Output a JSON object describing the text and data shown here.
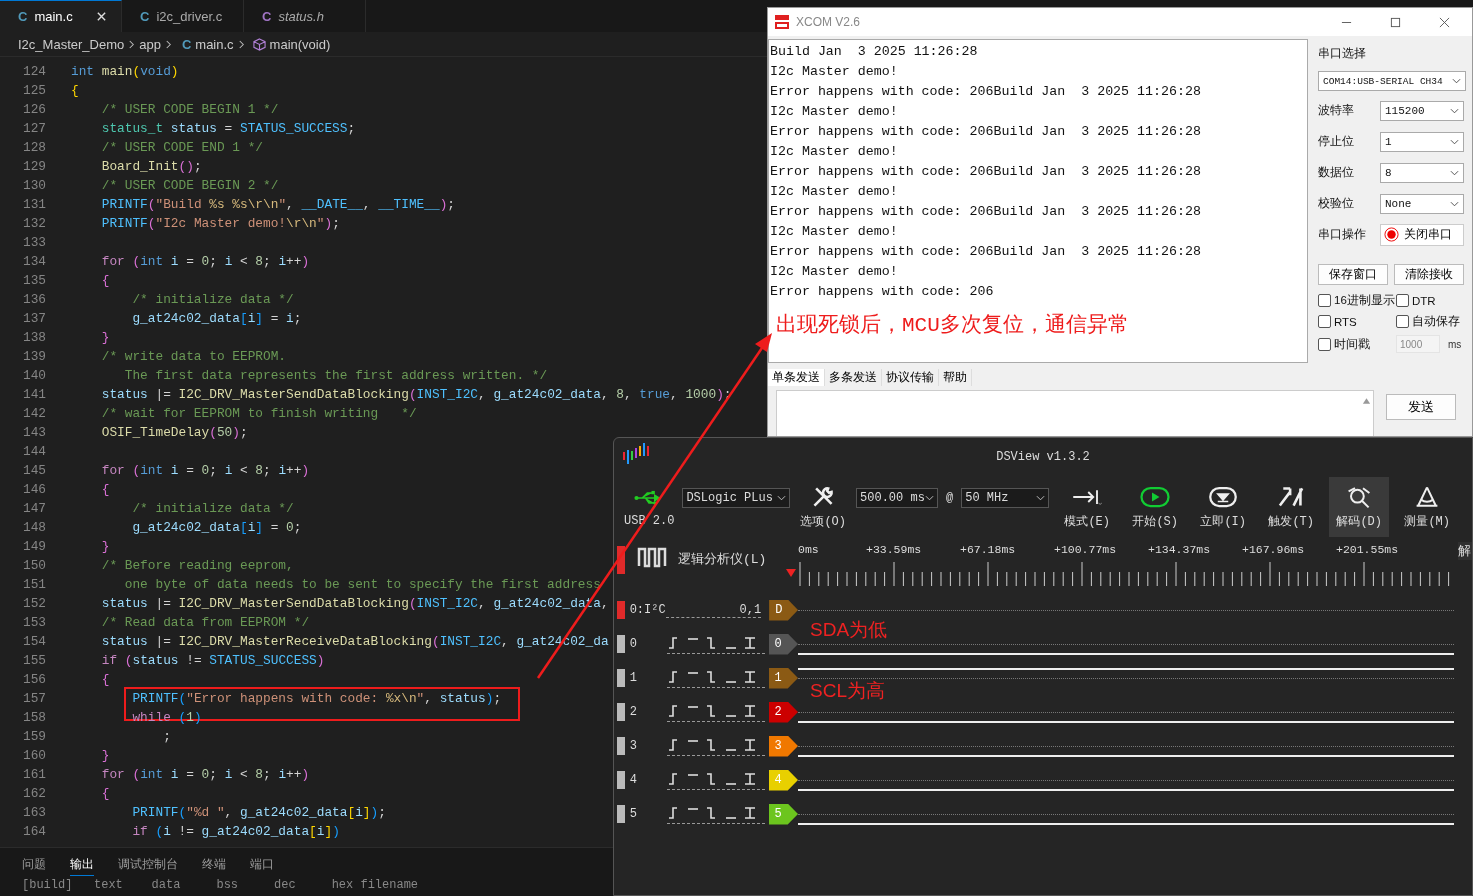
{
  "editor": {
    "tabs": [
      {
        "icon_letter": "C",
        "label": "main.c",
        "selected": true,
        "preview": false
      },
      {
        "icon_letter": "C",
        "label": "i2c_driver.c",
        "selected": false,
        "preview": false
      },
      {
        "icon_letter": "C",
        "label": "status.h",
        "selected": false,
        "preview": true
      }
    ],
    "breadcrumb": [
      {
        "kind": "folder",
        "label": "I2c_Master_Demo"
      },
      {
        "kind": "folder",
        "label": "app"
      },
      {
        "kind": "file",
        "icon_letter": "C",
        "label": "main.c"
      },
      {
        "kind": "function",
        "label": "main(void)"
      }
    ],
    "lines": [
      {
        "number": "124",
        "tokens": [
          {
            "text": "int ",
            "kind": "kw"
          },
          {
            "text": "main",
            "kind": "fn"
          },
          {
            "text": "(",
            "kind": "b1"
          },
          {
            "text": "void",
            "kind": "kw"
          },
          {
            "text": ")",
            "kind": "b1"
          }
        ]
      },
      {
        "number": "125",
        "tokens": [
          {
            "text": "{",
            "kind": "b1"
          }
        ]
      },
      {
        "number": "126",
        "tokens": [
          {
            "text": "    /* USER CODE BEGIN 1 */",
            "kind": "cm"
          }
        ]
      },
      {
        "number": "127",
        "tokens": [
          {
            "text": "    status_t ",
            "kind": "ty"
          },
          {
            "text": "status",
            "kind": "v"
          },
          {
            "text": " = ",
            "kind": "p"
          },
          {
            "text": "STATUS_SUCCESS",
            "kind": "c"
          },
          {
            "text": ";",
            "kind": "p"
          }
        ]
      },
      {
        "number": "128",
        "tokens": [
          {
            "text": "    /* USER CODE END 1 */",
            "kind": "cm"
          }
        ]
      },
      {
        "number": "129",
        "tokens": [
          {
            "text": "    Board_Init",
            "kind": "fn"
          },
          {
            "text": "()",
            "kind": "b2"
          },
          {
            "text": ";",
            "kind": "p"
          }
        ]
      },
      {
        "number": "130",
        "tokens": [
          {
            "text": "    /* USER CODE BEGIN 2 */",
            "kind": "cm"
          }
        ]
      },
      {
        "number": "131",
        "tokens": [
          {
            "text": "    PRINTF",
            "kind": "c"
          },
          {
            "text": "(",
            "kind": "b2"
          },
          {
            "text": "\"Build ",
            "kind": "s"
          },
          {
            "text": "%s %s\\r\\n",
            "kind": "e"
          },
          {
            "text": "\"",
            "kind": "s"
          },
          {
            "text": ", ",
            "kind": "p"
          },
          {
            "text": "__DATE__",
            "kind": "c"
          },
          {
            "text": ", ",
            "kind": "p"
          },
          {
            "text": "__TIME__",
            "kind": "c"
          },
          {
            "text": ")",
            "kind": "b2"
          },
          {
            "text": ";",
            "kind": "p"
          }
        ]
      },
      {
        "number": "132",
        "tokens": [
          {
            "text": "    PRINTF",
            "kind": "c"
          },
          {
            "text": "(",
            "kind": "b2"
          },
          {
            "text": "\"I2c Master demo!",
            "kind": "s"
          },
          {
            "text": "\\r\\n",
            "kind": "e"
          },
          {
            "text": "\"",
            "kind": "s"
          },
          {
            "text": ")",
            "kind": "b2"
          },
          {
            "text": ";",
            "kind": "p"
          }
        ]
      },
      {
        "number": "133"
      },
      {
        "number": "134",
        "tokens": [
          {
            "text": "    for ",
            "kind": "ctl"
          },
          {
            "text": "(",
            "kind": "b2"
          },
          {
            "text": "int ",
            "kind": "kw"
          },
          {
            "text": "i",
            "kind": "v"
          },
          {
            "text": " = ",
            "kind": "p"
          },
          {
            "text": "0",
            "kind": "n"
          },
          {
            "text": "; ",
            "kind": "p"
          },
          {
            "text": "i",
            "kind": "v"
          },
          {
            "text": " < ",
            "kind": "p"
          },
          {
            "text": "8",
            "kind": "n"
          },
          {
            "text": "; ",
            "kind": "p"
          },
          {
            "text": "i",
            "kind": "v"
          },
          {
            "text": "++",
            "kind": "p"
          },
          {
            "text": ")",
            "kind": "b2"
          }
        ]
      },
      {
        "number": "135",
        "tokens": [
          {
            "text": "    {",
            "kind": "b2"
          }
        ]
      },
      {
        "number": "136",
        "tokens": [
          {
            "text": "        /* initialize data */",
            "kind": "cm"
          }
        ]
      },
      {
        "number": "137",
        "tokens": [
          {
            "text": "        g_at24c02_data",
            "kind": "v"
          },
          {
            "text": "[",
            "kind": "b3"
          },
          {
            "text": "i",
            "kind": "v"
          },
          {
            "text": "]",
            "kind": "b3"
          },
          {
            "text": " = ",
            "kind": "p"
          },
          {
            "text": "i",
            "kind": "v"
          },
          {
            "text": ";",
            "kind": "p"
          }
        ]
      },
      {
        "number": "138",
        "tokens": [
          {
            "text": "    }",
            "kind": "b2"
          }
        ]
      },
      {
        "number": "139",
        "tokens": [
          {
            "text": "    /* write data to EEPROM.",
            "kind": "cm"
          }
        ]
      },
      {
        "number": "140",
        "tokens": [
          {
            "text": "       The first data represents the first address written. */",
            "kind": "cm"
          }
        ]
      },
      {
        "number": "141",
        "tokens": [
          {
            "text": "    status ",
            "kind": "v"
          },
          {
            "text": "|= ",
            "kind": "p"
          },
          {
            "text": "I2C_DRV_MasterSendDataBlocking",
            "kind": "fn"
          },
          {
            "text": "(",
            "kind": "b2"
          },
          {
            "text": "INST_I2C",
            "kind": "c"
          },
          {
            "text": ", ",
            "kind": "p"
          },
          {
            "text": "g_at24c02_data",
            "kind": "v"
          },
          {
            "text": ", ",
            "kind": "p"
          },
          {
            "text": "8",
            "kind": "n"
          },
          {
            "text": ", ",
            "kind": "p"
          },
          {
            "text": "true",
            "kind": "kw"
          },
          {
            "text": ", ",
            "kind": "p"
          },
          {
            "text": "1000",
            "kind": "n"
          },
          {
            "text": ")",
            "kind": "b2"
          },
          {
            "text": ";",
            "kind": "p"
          }
        ]
      },
      {
        "number": "142",
        "tokens": [
          {
            "text": "    /* wait for EEPROM to finish writing   */",
            "kind": "cm"
          }
        ]
      },
      {
        "number": "143",
        "tokens": [
          {
            "text": "    OSIF_TimeDelay",
            "kind": "fn"
          },
          {
            "text": "(",
            "kind": "b2"
          },
          {
            "text": "50",
            "kind": "n"
          },
          {
            "text": ")",
            "kind": "b2"
          },
          {
            "text": ";",
            "kind": "p"
          }
        ]
      },
      {
        "number": "144"
      },
      {
        "number": "145",
        "tokens": [
          {
            "text": "    for ",
            "kind": "ctl"
          },
          {
            "text": "(",
            "kind": "b2"
          },
          {
            "text": "int ",
            "kind": "kw"
          },
          {
            "text": "i",
            "kind": "v"
          },
          {
            "text": " = ",
            "kind": "p"
          },
          {
            "text": "0",
            "kind": "n"
          },
          {
            "text": "; ",
            "kind": "p"
          },
          {
            "text": "i",
            "kind": "v"
          },
          {
            "text": " < ",
            "kind": "p"
          },
          {
            "text": "8",
            "kind": "n"
          },
          {
            "text": "; ",
            "kind": "p"
          },
          {
            "text": "i",
            "kind": "v"
          },
          {
            "text": "++",
            "kind": "p"
          },
          {
            "text": ")",
            "kind": "b2"
          }
        ]
      },
      {
        "number": "146",
        "tokens": [
          {
            "text": "    {",
            "kind": "b2"
          }
        ]
      },
      {
        "number": "147",
        "tokens": [
          {
            "text": "        /* initialize data */",
            "kind": "cm"
          }
        ]
      },
      {
        "number": "148",
        "tokens": [
          {
            "text": "        g_at24c02_data",
            "kind": "v"
          },
          {
            "text": "[",
            "kind": "b3"
          },
          {
            "text": "i",
            "kind": "v"
          },
          {
            "text": "]",
            "kind": "b3"
          },
          {
            "text": " = ",
            "kind": "p"
          },
          {
            "text": "0",
            "kind": "n"
          },
          {
            "text": ";",
            "kind": "p"
          }
        ]
      },
      {
        "number": "149",
        "tokens": [
          {
            "text": "    }",
            "kind": "b2"
          }
        ]
      },
      {
        "number": "150",
        "tokens": [
          {
            "text": "    /* Before reading eeprom,",
            "kind": "cm"
          }
        ]
      },
      {
        "number": "151",
        "tokens": [
          {
            "text": "       one byte of data needs to be sent to specify the first address",
            "kind": "cm"
          }
        ]
      },
      {
        "number": "152",
        "tokens": [
          {
            "text": "    status ",
            "kind": "v"
          },
          {
            "text": "|= ",
            "kind": "p"
          },
          {
            "text": "I2C_DRV_MasterSendDataBlocking",
            "kind": "fn"
          },
          {
            "text": "(",
            "kind": "b2"
          },
          {
            "text": "INST_I2C",
            "kind": "c"
          },
          {
            "text": ", ",
            "kind": "p"
          },
          {
            "text": "g_at24c02_data",
            "kind": "v"
          },
          {
            "text": ",",
            "kind": "p"
          }
        ]
      },
      {
        "number": "153",
        "tokens": [
          {
            "text": "    /* Read data from EEPROM */",
            "kind": "cm"
          }
        ]
      },
      {
        "number": "154",
        "tokens": [
          {
            "text": "    status ",
            "kind": "v"
          },
          {
            "text": "|= ",
            "kind": "p"
          },
          {
            "text": "I2C_DRV_MasterReceiveDataBlocking",
            "kind": "fn"
          },
          {
            "text": "(",
            "kind": "b2"
          },
          {
            "text": "INST_I2C",
            "kind": "c"
          },
          {
            "text": ", ",
            "kind": "p"
          },
          {
            "text": "g_at24c02_da",
            "kind": "v"
          }
        ]
      },
      {
        "number": "155",
        "tokens": [
          {
            "text": "    if ",
            "kind": "ctl"
          },
          {
            "text": "(",
            "kind": "b2"
          },
          {
            "text": "status ",
            "kind": "v"
          },
          {
            "text": "!= ",
            "kind": "p"
          },
          {
            "text": "STATUS_SUCCESS",
            "kind": "c"
          },
          {
            "text": ")",
            "kind": "b2"
          }
        ]
      },
      {
        "number": "156",
        "tokens": [
          {
            "text": "    {",
            "kind": "b2"
          }
        ]
      },
      {
        "number": "157",
        "boxed": true,
        "tokens": [
          {
            "text": "        PRINTF",
            "kind": "c"
          },
          {
            "text": "(",
            "kind": "b3"
          },
          {
            "text": "\"Error happens with code: ",
            "kind": "s"
          },
          {
            "text": "%x\\n",
            "kind": "e"
          },
          {
            "text": "\"",
            "kind": "s"
          },
          {
            "text": ", ",
            "kind": "p"
          },
          {
            "text": "status",
            "kind": "v"
          },
          {
            "text": ")",
            "kind": "b3"
          },
          {
            "text": ";",
            "kind": "p"
          }
        ]
      },
      {
        "number": "158",
        "tokens": [
          {
            "text": "        while ",
            "kind": "ctl"
          },
          {
            "text": "(",
            "kind": "b3"
          },
          {
            "text": "1",
            "kind": "n"
          },
          {
            "text": ")",
            "kind": "b3"
          }
        ]
      },
      {
        "number": "159",
        "tokens": [
          {
            "text": "            ;",
            "kind": "p"
          }
        ]
      },
      {
        "number": "160",
        "tokens": [
          {
            "text": "    }",
            "kind": "b2"
          }
        ]
      },
      {
        "number": "161",
        "tokens": [
          {
            "text": "    for ",
            "kind": "ctl"
          },
          {
            "text": "(",
            "kind": "b2"
          },
          {
            "text": "int ",
            "kind": "kw"
          },
          {
            "text": "i",
            "kind": "v"
          },
          {
            "text": " = ",
            "kind": "p"
          },
          {
            "text": "0",
            "kind": "n"
          },
          {
            "text": "; ",
            "kind": "p"
          },
          {
            "text": "i",
            "kind": "v"
          },
          {
            "text": " < ",
            "kind": "p"
          },
          {
            "text": "8",
            "kind": "n"
          },
          {
            "text": "; ",
            "kind": "p"
          },
          {
            "text": "i",
            "kind": "v"
          },
          {
            "text": "++",
            "kind": "p"
          },
          {
            "text": ")",
            "kind": "b2"
          }
        ]
      },
      {
        "number": "162",
        "tokens": [
          {
            "text": "    {",
            "kind": "b2"
          }
        ]
      },
      {
        "number": "163",
        "tokens": [
          {
            "text": "        PRINTF",
            "kind": "c"
          },
          {
            "text": "(",
            "kind": "b3"
          },
          {
            "text": "\"%d \"",
            "kind": "s"
          },
          {
            "text": ", ",
            "kind": "p"
          },
          {
            "text": "g_at24c02_data",
            "kind": "v"
          },
          {
            "text": "[",
            "kind": "b1"
          },
          {
            "text": "i",
            "kind": "v"
          },
          {
            "text": "]",
            "kind": "b1"
          },
          {
            "text": ")",
            "kind": "b3"
          },
          {
            "text": ";",
            "kind": "p"
          }
        ]
      },
      {
        "number": "164",
        "tokens": [
          {
            "text": "        if ",
            "kind": "ctl"
          },
          {
            "text": "(",
            "kind": "b3"
          },
          {
            "text": "i ",
            "kind": "v"
          },
          {
            "text": "!= ",
            "kind": "p"
          },
          {
            "text": "g_at24c02_data",
            "kind": "v"
          },
          {
            "text": "[",
            "kind": "b1"
          },
          {
            "text": "i",
            "kind": "v"
          },
          {
            "text": "]",
            "kind": "b1"
          },
          {
            "text": ")",
            "kind": "b3"
          }
        ]
      }
    ],
    "panel_tabs": [
      {
        "label": "问题",
        "selected": false
      },
      {
        "label": "输出",
        "selected": true
      },
      {
        "label": "调试控制台",
        "selected": false
      },
      {
        "label": "终端",
        "selected": false
      },
      {
        "label": "端口",
        "selected": false
      }
    ],
    "output_line": "[build]   text    data     bss     dec     hex filename"
  },
  "serial_tool": {
    "title": "XCOM V2.6",
    "received": [
      "Build Jan  3 2025 11:26:28",
      "I2c Master demo!",
      "Error happens with code: 206Build Jan  3 2025 11:26:28",
      "I2c Master demo!",
      "Error happens with code: 206Build Jan  3 2025 11:26:28",
      "I2c Master demo!",
      "Error happens with code: 206Build Jan  3 2025 11:26:28",
      "I2c Master demo!",
      "Error happens with code: 206Build Jan  3 2025 11:26:28",
      "I2c Master demo!",
      "Error happens with code: 206Build Jan  3 2025 11:26:28",
      "I2c Master demo!",
      "Error happens with code: 206"
    ],
    "annotation": "出现死锁后，MCU多次复位，通信异常",
    "port_label": "串口选择",
    "port": "COM14:USB-SERIAL CH34",
    "settings": [
      {
        "kind": "select",
        "label": "波特率",
        "value": "115200"
      },
      {
        "kind": "select",
        "label": "停止位",
        "value": "1"
      },
      {
        "kind": "select",
        "label": "数据位",
        "value": "8"
      },
      {
        "kind": "select",
        "label": "校验位",
        "value": "None"
      },
      {
        "kind": "toggle",
        "label": "串口操作",
        "value": "关闭串口",
        "on": true
      }
    ],
    "buttons": [
      "保存窗口",
      "清除接收"
    ],
    "options": [
      {
        "label": "16进制显示",
        "checked": false
      },
      {
        "label": "DTR",
        "checked": false
      },
      {
        "label": "RTS",
        "checked": false
      },
      {
        "label": "自动保存",
        "checked": false
      },
      {
        "label": "时间戳",
        "checked": false
      }
    ],
    "interval": {
      "placeholder": "1000",
      "unit": "ms"
    },
    "send_tabs": [
      {
        "label": "单条发送",
        "selected": true
      },
      {
        "label": "多条发送",
        "selected": false
      },
      {
        "label": "协议传输",
        "selected": false
      },
      {
        "label": "帮助",
        "selected": false
      }
    ],
    "send_button": "发送"
  },
  "analyzer": {
    "title": "DSView v1.3.2",
    "usb_label": "USB 2.0",
    "device": "DSLogic PLus",
    "options_label": "选项(O)",
    "duration": "500.00 ms",
    "at": "@",
    "rate": "50 MHz",
    "tools": [
      {
        "kind": "mode",
        "label": "模式(E)",
        "selected": false
      },
      {
        "kind": "start",
        "label": "开始(S)",
        "selected": false
      },
      {
        "kind": "instant",
        "label": "立即(I)",
        "selected": false
      },
      {
        "kind": "trigger",
        "label": "触发(T)",
        "selected": false
      },
      {
        "kind": "decode",
        "label": "解码(D)",
        "selected": true
      },
      {
        "kind": "measure",
        "label": "测量(M)",
        "selected": false
      }
    ],
    "mode_label": "逻辑分析仪(L)",
    "time_labels": [
      "0ms",
      "+33.59ms",
      "+67.18ms",
      "+100.77ms",
      "+134.37ms",
      "+167.96ms",
      "+201.55ms"
    ],
    "side_tab": "解",
    "decoder": {
      "label": "0:I²C",
      "channels": "0,1",
      "tag": "D",
      "color": "#8b5a14"
    },
    "channels": [
      {
        "label": "0",
        "tag": "0",
        "color": "#555555",
        "high": false
      },
      {
        "label": "1",
        "tag": "1",
        "color": "#8b5a14",
        "high": true
      },
      {
        "label": "2",
        "tag": "2",
        "color": "#cc0000",
        "high": false
      },
      {
        "label": "3",
        "tag": "3",
        "color": "#f07800",
        "high": false
      },
      {
        "label": "4",
        "tag": "4",
        "color": "#e8d000",
        "high": false
      },
      {
        "label": "5",
        "tag": "5",
        "color": "#6cc51e",
        "high": false
      }
    ],
    "notes": [
      "SDA为低",
      "SCL为高"
    ]
  }
}
